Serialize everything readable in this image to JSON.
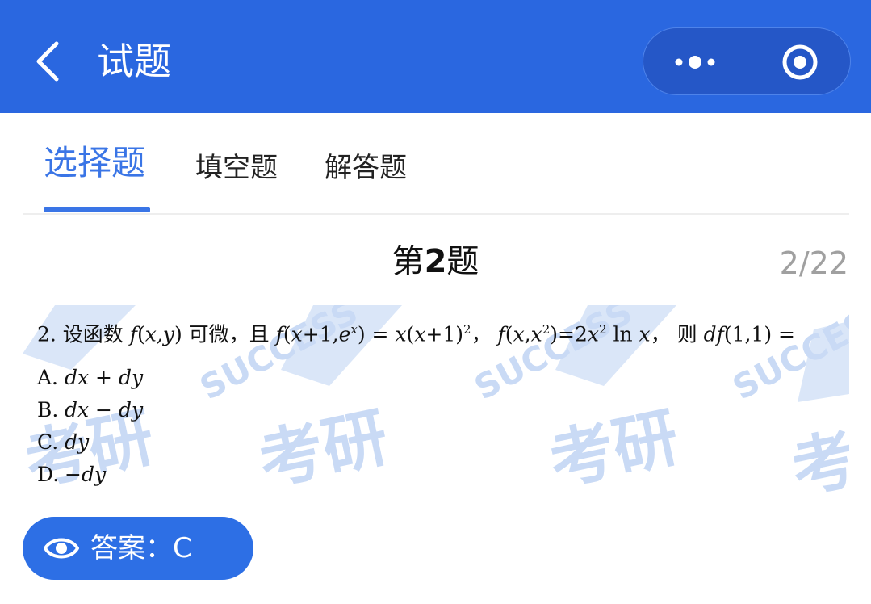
{
  "header": {
    "title": "试题",
    "accent_color": "#2a67e0",
    "icons": [
      "chevron-left-icon",
      "more-dots-icon",
      "target-icon"
    ]
  },
  "tabs": [
    {
      "label": "选择题",
      "active": true
    },
    {
      "label": "填空题",
      "active": false
    },
    {
      "label": "解答题",
      "active": false
    }
  ],
  "question": {
    "title_prefix": "第",
    "title_number": "2",
    "title_suffix": "题",
    "counter": "2/22",
    "stem": {
      "p1": "2. 设函数 ",
      "f1": "f",
      "p2": "(",
      "xy": "x,y",
      "p3": ") 可微，且 ",
      "f2": "f",
      "p4": "(",
      "x1": "x",
      "p5": "+1,",
      "e": "e",
      "ex": "x",
      "p6": ") = ",
      "x2": "x",
      "p7": "(",
      "x3": "x",
      "p8": "+1)",
      "sq1": "2",
      "p9": "，  ",
      "f3": "f",
      "p10": "(",
      "x4": "x",
      "p11": ",",
      "x5": "x",
      "sq2": "2",
      "p12": ")=2",
      "x6": "x",
      "sq3": "2",
      "p13": " ln ",
      "x7": "x",
      "p14": "，  则 ",
      "df": "df",
      "p15": "(1,1) ="
    },
    "options": [
      {
        "letter": "A.",
        "expr": "dx + dy"
      },
      {
        "letter": "B.",
        "expr": "dx − dy"
      },
      {
        "letter": "C.",
        "expr": "dy"
      },
      {
        "letter": "D.",
        "expr": "−dy"
      }
    ]
  },
  "watermark": {
    "brand_text": "SUCCESS",
    "cn_text": "考研"
  },
  "answer": {
    "label": "答案：C",
    "icon": "eye-icon",
    "color": "#2d6fe5"
  }
}
